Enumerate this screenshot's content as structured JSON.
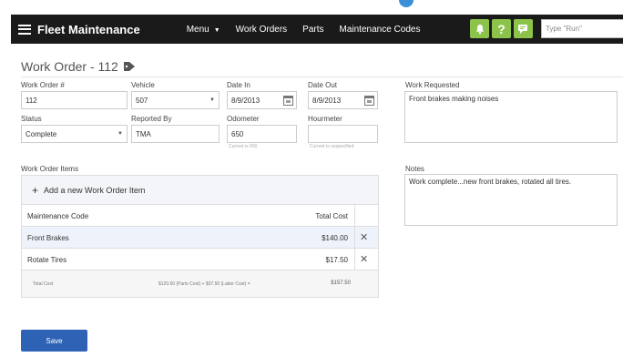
{
  "nav": {
    "brand": "Fleet Maintenance",
    "items": [
      {
        "label": "Menu",
        "has_caret": true
      },
      {
        "label": "Work Orders"
      },
      {
        "label": "Parts"
      },
      {
        "label": "Maintenance Codes"
      }
    ],
    "icons": [
      "bell-icon",
      "help-icon",
      "chat-icon"
    ],
    "search_placeholder": "Type \"Run\"",
    "icon_color": "#8cc34a"
  },
  "page": {
    "title": "Work Order - 112"
  },
  "form": {
    "work_order_label": "Work Order #",
    "work_order_value": "112",
    "vehicle_label": "Vehicle",
    "vehicle_value": "507",
    "date_in_label": "Date In",
    "date_in_value": "8/9/2013",
    "date_out_label": "Date Out",
    "date_out_value": "8/9/2013",
    "status_label": "Status",
    "status_value": "Complete",
    "reported_by_label": "Reported By",
    "reported_by_value": "TMA",
    "odometer_label": "Odometer",
    "odometer_value": "650",
    "odometer_hint": "Current is 650",
    "hourmeter_label": "Hourmeter",
    "hourmeter_value": "",
    "hourmeter_hint": "Current is unspecified",
    "work_requested_label": "Work Requested",
    "work_requested_value": "Front brakes making noises",
    "notes_label": "Notes",
    "notes_value": "Work complete...new front brakes, rotated all tires."
  },
  "items": {
    "section_label": "Work Order Items",
    "add_label": "Add a new Work Order Item",
    "columns": [
      "Maintenance Code",
      "Total Cost"
    ],
    "rows": [
      {
        "code": "Front Brakes",
        "cost": "$140.00",
        "selected": true
      },
      {
        "code": "Rotate Tires",
        "cost": "$17.50",
        "selected": false
      }
    ],
    "total_label": "Total Cost",
    "total_breakdown": "$120.00 (Parts Cost) + $37.50 (Labor Cost) =",
    "total_value": "$157.50"
  },
  "actions": {
    "save_label": "Save"
  },
  "colors": {
    "navbar": "#1a1a1a",
    "save_button": "#2d62b4",
    "selected_row": "#eef3fb"
  }
}
